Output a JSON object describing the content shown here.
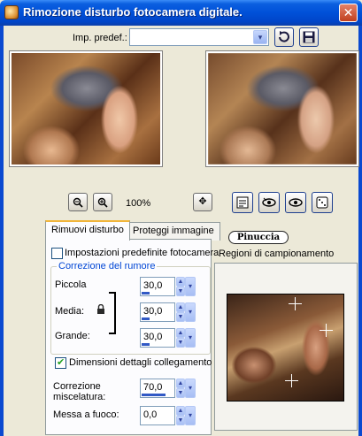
{
  "window": {
    "title": "Rimozione disturbo fotocamera digitale.",
    "close_symbol": "✕"
  },
  "preset": {
    "label": "Imp. predef.:",
    "value": "",
    "dropdown_symbol": "▾",
    "reset_icon": "reset-icon",
    "save_icon": "save-icon"
  },
  "preview": {
    "zoom_label": "100%",
    "zoom_out_symbol": "🔍",
    "zoom_in_symbol": "🔍",
    "pan_symbol": "✥",
    "buttons": [
      "options-icon",
      "proof-icon",
      "preview-eye-icon",
      "randomize-icon"
    ]
  },
  "tabs": [
    {
      "label": "Rimuovi disturbo",
      "active": true
    },
    {
      "label": "Proteggi immagine",
      "active": false
    }
  ],
  "noise": {
    "default_presets_label": "Impostazioni predefinite fotocamera",
    "default_presets_checked": false,
    "group_title": "Correzione del rumore",
    "small_label": "Piccola",
    "small_value": "30,0",
    "medium_label": "Media:",
    "medium_value": "30,0",
    "large_label": "Grande:",
    "large_value": "30,0",
    "link_label": "Dimensioni dettagli collegamento",
    "link_checked": true,
    "blend_label_1": "Correzione",
    "blend_label_2": "miscelatura:",
    "blend_value": "70,0",
    "sharpen_label": "Messa a fuoco:",
    "sharpen_value": "0,0"
  },
  "regions": {
    "signature": "Pinuccia",
    "label": "Regioni di campionamento"
  },
  "spinner_symbols": {
    "up": "▲",
    "down": "▼",
    "dropdown": "▾"
  },
  "colors": {
    "titlebar": "#0050d8",
    "accent": "#0046d5",
    "tab_highlight": "#f1b53a"
  }
}
